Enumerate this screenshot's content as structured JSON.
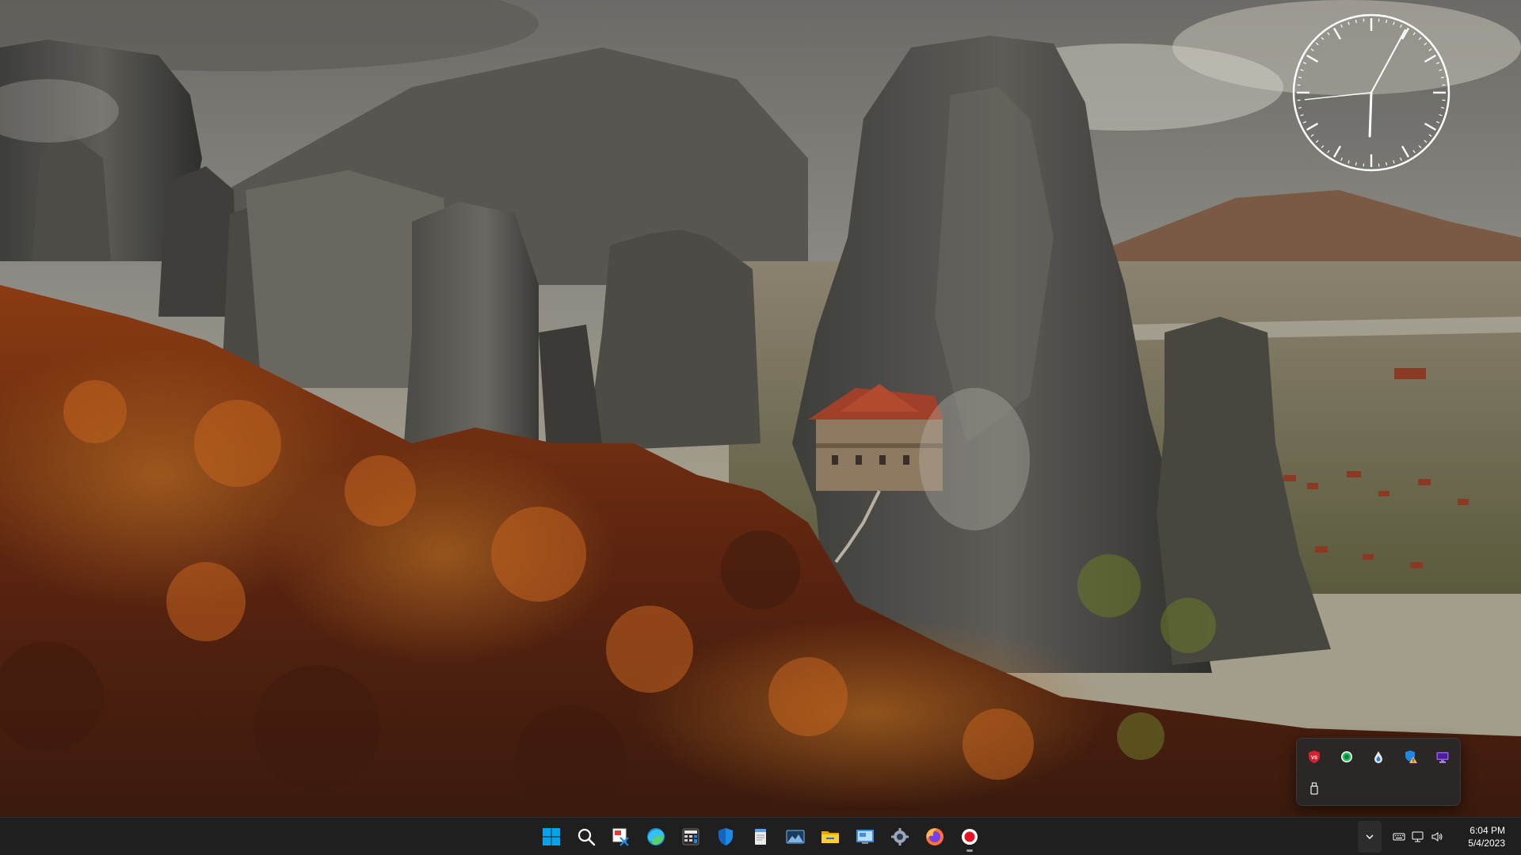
{
  "taskbar": {
    "apps": [
      {
        "name": "start-button",
        "icon": "windows-logo-icon"
      },
      {
        "name": "search-button",
        "icon": "search-icon"
      },
      {
        "name": "snipping-tool-button",
        "icon": "snipping-tool-icon"
      },
      {
        "name": "edge-browser-button",
        "icon": "edge-icon"
      },
      {
        "name": "calculator-button",
        "icon": "calculator-icon"
      },
      {
        "name": "windows-security-button",
        "icon": "shield-icon"
      },
      {
        "name": "notepad-button",
        "icon": "notepad-icon"
      },
      {
        "name": "photos-button",
        "icon": "photos-icon"
      },
      {
        "name": "file-explorer-button",
        "icon": "folder-icon"
      },
      {
        "name": "control-panel-button",
        "icon": "control-panel-icon"
      },
      {
        "name": "settings-button",
        "icon": "gear-icon"
      },
      {
        "name": "firefox-button",
        "icon": "firefox-icon"
      },
      {
        "name": "screen-recorder-button",
        "icon": "record-icon",
        "active": true
      }
    ],
    "time": "6:04 PM",
    "date": "5/4/2023"
  },
  "tray_flyout": {
    "icons": [
      "vs-shield-icon",
      "green-circle-icon",
      "water-drop-icon",
      "defender-warning-icon",
      "purple-monitor-icon",
      "usb-drive-icon"
    ]
  },
  "clock_gadget": {
    "hour": 6,
    "minute": 4,
    "second": 44
  },
  "colors": {
    "taskbar_bg": "#1f1f1f",
    "accent_red": "#e81123",
    "windows_blue": "#00a4ef"
  }
}
